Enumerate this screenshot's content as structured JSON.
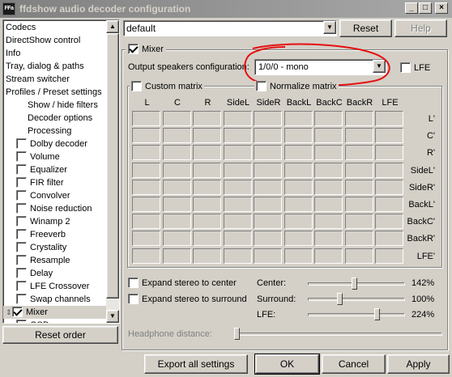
{
  "window": {
    "title": "ffdshow audio decoder configuration",
    "icon_text": "FFa",
    "minimize": "_",
    "maximize": "□",
    "close": "×"
  },
  "sidebar": {
    "items": [
      {
        "label": "Codecs",
        "type": "category"
      },
      {
        "label": "DirectShow control",
        "type": "category"
      },
      {
        "label": "Info",
        "type": "category"
      },
      {
        "label": "Tray, dialog & paths",
        "type": "category"
      },
      {
        "label": "Stream switcher",
        "type": "category"
      },
      {
        "label": "Profiles / Preset settings",
        "type": "category"
      },
      {
        "label": "Show / hide filters",
        "type": "sub"
      },
      {
        "label": "Decoder options",
        "type": "sub"
      },
      {
        "label": "Processing",
        "type": "sub"
      },
      {
        "label": "Dolby decoder",
        "type": "filter",
        "checked": false
      },
      {
        "label": "Volume",
        "type": "filter",
        "checked": false
      },
      {
        "label": "Equalizer",
        "type": "filter",
        "checked": false
      },
      {
        "label": "FIR filter",
        "type": "filter",
        "checked": false
      },
      {
        "label": "Convolver",
        "type": "filter",
        "checked": false
      },
      {
        "label": "Noise reduction",
        "type": "filter",
        "checked": false
      },
      {
        "label": "Winamp 2",
        "type": "filter",
        "checked": false
      },
      {
        "label": "Freeverb",
        "type": "filter",
        "checked": false
      },
      {
        "label": "Crystality",
        "type": "filter",
        "checked": false
      },
      {
        "label": "Resample",
        "type": "filter",
        "checked": false
      },
      {
        "label": "Delay",
        "type": "filter",
        "checked": false
      },
      {
        "label": "LFE Crossover",
        "type": "filter",
        "checked": false
      },
      {
        "label": "Swap channels",
        "type": "filter",
        "checked": false
      },
      {
        "label": "Mixer",
        "type": "filter",
        "checked": true,
        "selected": true
      },
      {
        "label": "OSD",
        "type": "filter",
        "checked": false
      }
    ],
    "reset_order": "Reset order"
  },
  "preset": {
    "value": "default",
    "reset": "Reset",
    "help": "Help"
  },
  "mixer": {
    "title": "Mixer",
    "enabled": true,
    "output_label": "Output speakers configuration:",
    "output_value": "1/0/0 - mono",
    "lfe_label": "LFE",
    "custom_matrix": "Custom matrix",
    "normalize_matrix": "Normalize matrix",
    "columns": [
      "L",
      "C",
      "R",
      "SideL",
      "SideR",
      "BackL",
      "BackC",
      "BackR",
      "LFE"
    ],
    "rows": [
      "L'",
      "C'",
      "R'",
      "SideL'",
      "SideR'",
      "BackL'",
      "BackC'",
      "BackR'",
      "LFE'"
    ],
    "expand_center": "Expand stereo to center",
    "expand_surround": "Expand stereo to surround",
    "sliders": [
      {
        "label": "Center:",
        "value": "142%",
        "level": 0.45
      },
      {
        "label": "Surround:",
        "value": "100%",
        "level": 0.3
      },
      {
        "label": "LFE:",
        "value": "224%",
        "level": 0.68
      }
    ],
    "headphone_label": "Headphone distance:",
    "headphone_level": 0.0
  },
  "footer": {
    "export": "Export all settings",
    "ok": "OK",
    "cancel": "Cancel",
    "apply": "Apply"
  }
}
